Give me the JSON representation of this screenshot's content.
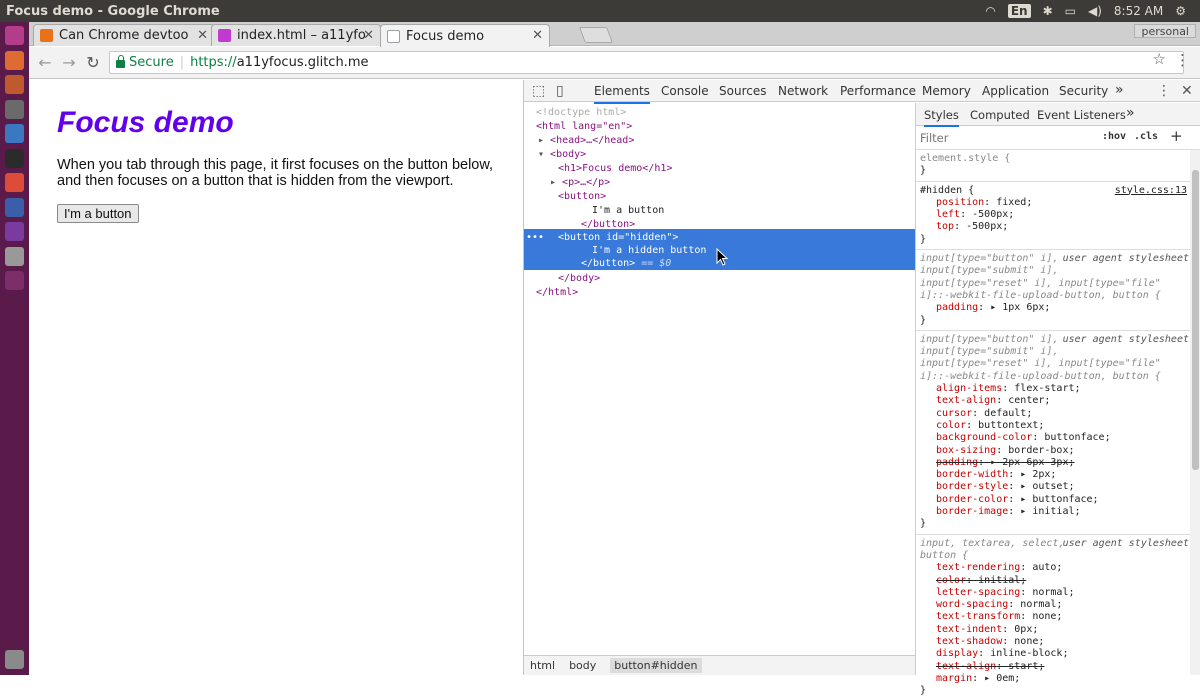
{
  "window": {
    "title": "Focus demo - Google Chrome"
  },
  "tray": {
    "lang": "En",
    "time": "8:52 AM"
  },
  "tabs": [
    {
      "label": "Can Chrome devtoo",
      "color": "#e8711a"
    },
    {
      "label": "index.html – a11yfo",
      "color": "#c03ad0"
    },
    {
      "label": "Focus demo",
      "color": "#9aa0a6"
    }
  ],
  "profile": "personal",
  "omnibox": {
    "secure": "Secure",
    "scheme": "https://",
    "host": "a11yfocus.glitch.me"
  },
  "page": {
    "heading": "Focus demo",
    "paragraph": "When you tab through this page, it first focuses on the button below, and then focuses on a button that is hidden from the viewport.",
    "button": "I'm a button"
  },
  "devtools": {
    "tabs": [
      "Elements",
      "Console",
      "Sources",
      "Network",
      "Performance",
      "Memory",
      "Application",
      "Security"
    ],
    "more": "»",
    "breadcrumbs": [
      "html",
      "body",
      "button#hidden"
    ],
    "dom": {
      "doctype": "<!doctype html>",
      "html_open": "<html lang=\"en\">",
      "head": "<head>…</head>",
      "body_open": "<body>",
      "h1": "<h1>Focus demo</h1>",
      "p": "<p>…</p>",
      "btn_open": "<button>",
      "btn_text": "I'm a button",
      "btn_close": "</button>",
      "hidden_open": "<button id=\"hidden\">",
      "hidden_text": "I'm a hidden button",
      "hidden_close": "</button>",
      "hidden_marker": "== $0",
      "body_close": "</body>",
      "html_close": "</html>",
      "dots": "•••"
    },
    "styles": {
      "tabs": [
        "Styles",
        "Computed",
        "Event Listeners"
      ],
      "more": "»",
      "filter_placeholder": "Filter",
      "hov": ":hov",
      "cls": ".cls",
      "plus": "+",
      "element_style": "element.style {",
      "close_brace": "}",
      "hidden_rule": {
        "selector": "#hidden {",
        "source": "style.css:13",
        "decls": [
          [
            "position",
            "fixed;"
          ],
          [
            "left",
            "-500px;"
          ],
          [
            "top",
            "-500px;"
          ]
        ]
      },
      "ua_label": "user agent stylesheet",
      "ua1_selector": [
        "input[type=\"button\" i],",
        "input[type=\"submit\" i],",
        "input[type=\"reset\" i], input[type=\"file\"",
        "i]::-webkit-file-upload-button, button {"
      ],
      "ua1_decls": [
        [
          "padding",
          "▸ 1px 6px;"
        ]
      ],
      "ua2_selector": [
        "input[type=\"button\" i],",
        "input[type=\"submit\" i],",
        "input[type=\"reset\" i], input[type=\"file\"",
        "i]::-webkit-file-upload-button, button {"
      ],
      "ua2_decls": [
        [
          "align-items",
          "flex-start;",
          false
        ],
        [
          "text-align",
          "center;",
          false
        ],
        [
          "cursor",
          "default;",
          false
        ],
        [
          "color",
          "buttontext;",
          false
        ],
        [
          "background-color",
          "buttonface;",
          false
        ],
        [
          "box-sizing",
          "border-box;",
          false
        ],
        [
          "padding",
          "▸ 2px 6px 3px;",
          true
        ],
        [
          "border-width",
          "▸ 2px;",
          false
        ],
        [
          "border-style",
          "▸ outset;",
          false
        ],
        [
          "border-color",
          "▸ buttonface;",
          false
        ],
        [
          "border-image",
          "▸ initial;",
          false
        ]
      ],
      "ua3_selector": [
        "input, textarea, select,",
        "button {"
      ],
      "ua3_decls": [
        [
          "text-rendering",
          "auto;",
          false
        ],
        [
          "color",
          "initial;",
          true
        ],
        [
          "letter-spacing",
          "normal;",
          false
        ],
        [
          "word-spacing",
          "normal;",
          false
        ],
        [
          "text-transform",
          "none;",
          false
        ],
        [
          "text-indent",
          "0px;",
          false
        ],
        [
          "text-shadow",
          "none;",
          false
        ],
        [
          "display",
          "inline-block;",
          false
        ],
        [
          "text-align",
          "start;",
          true
        ],
        [
          "margin",
          "▸ 0em;",
          false
        ]
      ]
    }
  },
  "launcher_icons": [
    "#b33d8a",
    "#e06b32",
    "#c05a2e",
    "#6a6a6a",
    "#3a78c2",
    "#2b2b2b",
    "#dd4b39",
    "#3b5ea8",
    "#7a3aa0",
    "#999999",
    "#7c2d6a"
  ]
}
